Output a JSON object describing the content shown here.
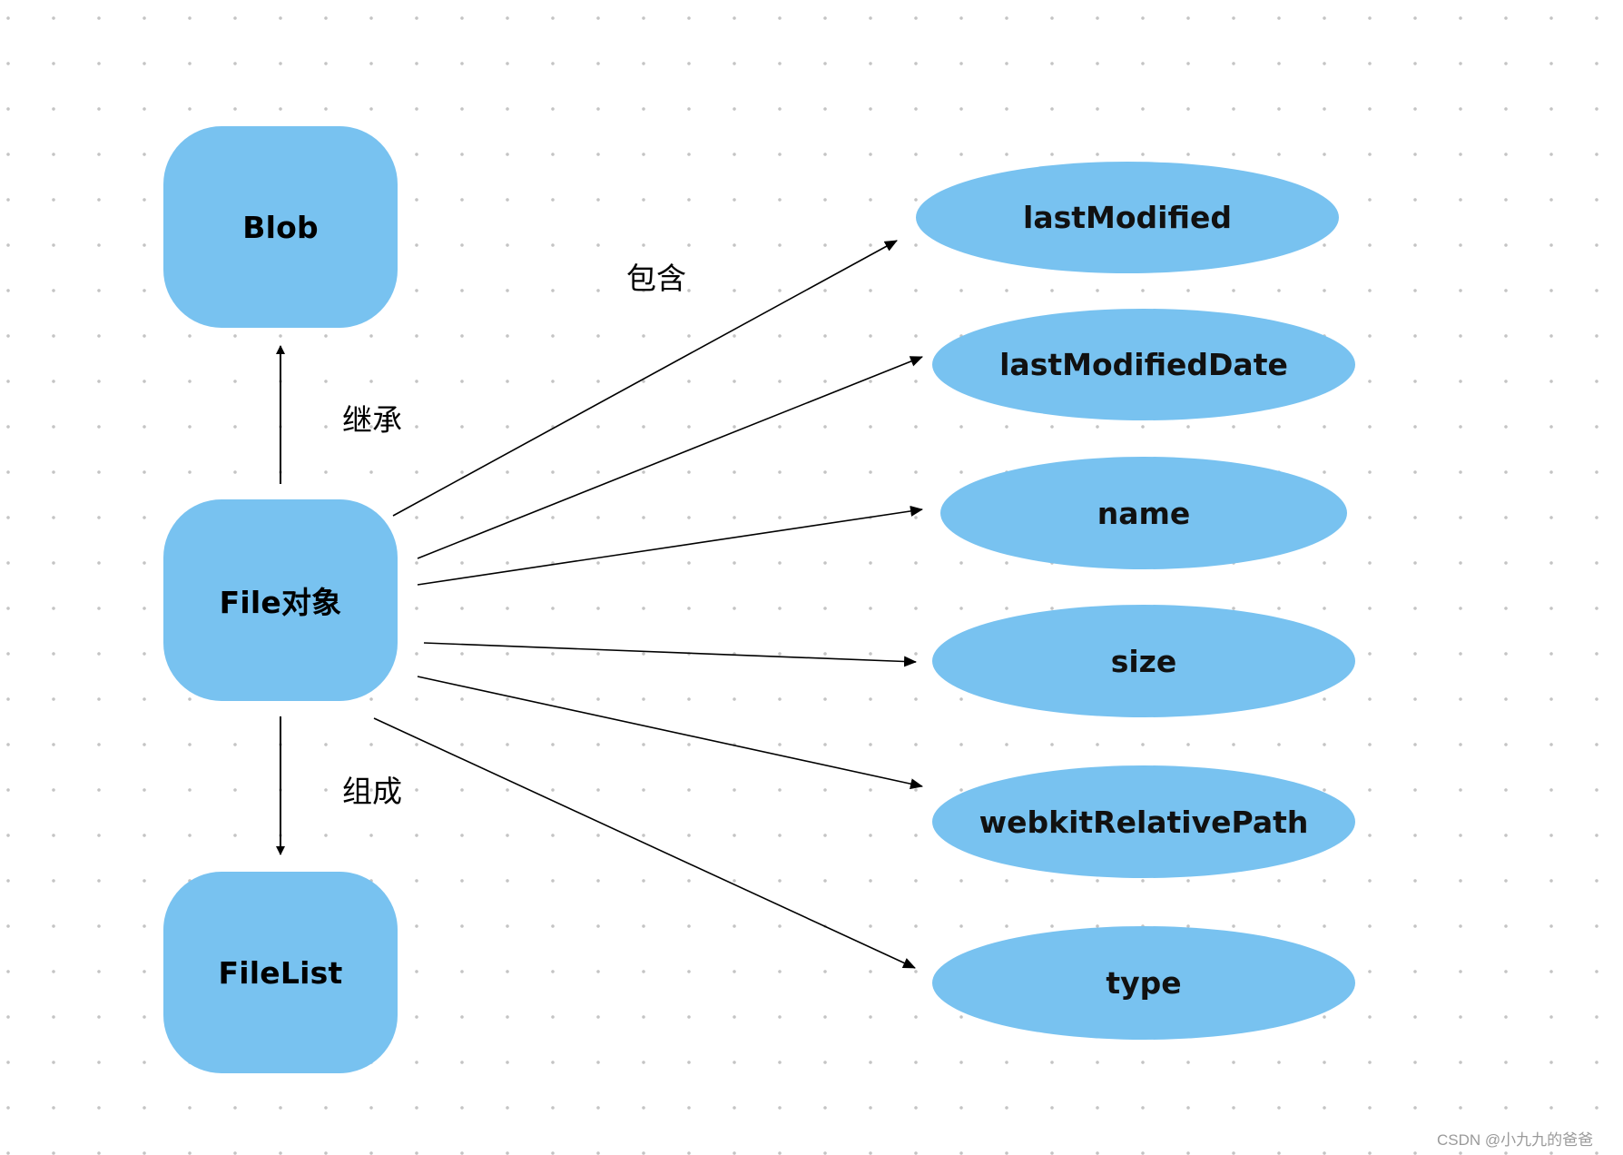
{
  "diagram": {
    "colors": {
      "node_fill": "#78c2f0",
      "edge": "#000000",
      "text": "#000000",
      "watermark": "#9a9a9a",
      "grid_dot": "#c4c4c4"
    },
    "nodes": {
      "blob": {
        "label": "Blob"
      },
      "file": {
        "label": "File对象"
      },
      "filelist": {
        "label": "FileList"
      }
    },
    "properties": [
      {
        "label": "lastModified"
      },
      {
        "label": "lastModifiedDate"
      },
      {
        "label": "name"
      },
      {
        "label": "size"
      },
      {
        "label": "webkitRelativePath"
      },
      {
        "label": "type"
      }
    ],
    "edge_labels": {
      "inherit": "继承",
      "compose": "组成",
      "contain": "包含"
    },
    "edges": [
      {
        "from": "File对象",
        "to": "Blob",
        "relation": "继承"
      },
      {
        "from": "File对象",
        "to": "FileList",
        "relation": "组成"
      },
      {
        "from": "File对象",
        "to": "lastModified",
        "relation": "包含"
      },
      {
        "from": "File对象",
        "to": "lastModifiedDate",
        "relation": "包含"
      },
      {
        "from": "File对象",
        "to": "name",
        "relation": "包含"
      },
      {
        "from": "File对象",
        "to": "size",
        "relation": "包含"
      },
      {
        "from": "File对象",
        "to": "webkitRelativePath",
        "relation": "包含"
      },
      {
        "from": "File对象",
        "to": "type",
        "relation": "包含"
      }
    ]
  },
  "watermark": "CSDN @小九九的爸爸"
}
